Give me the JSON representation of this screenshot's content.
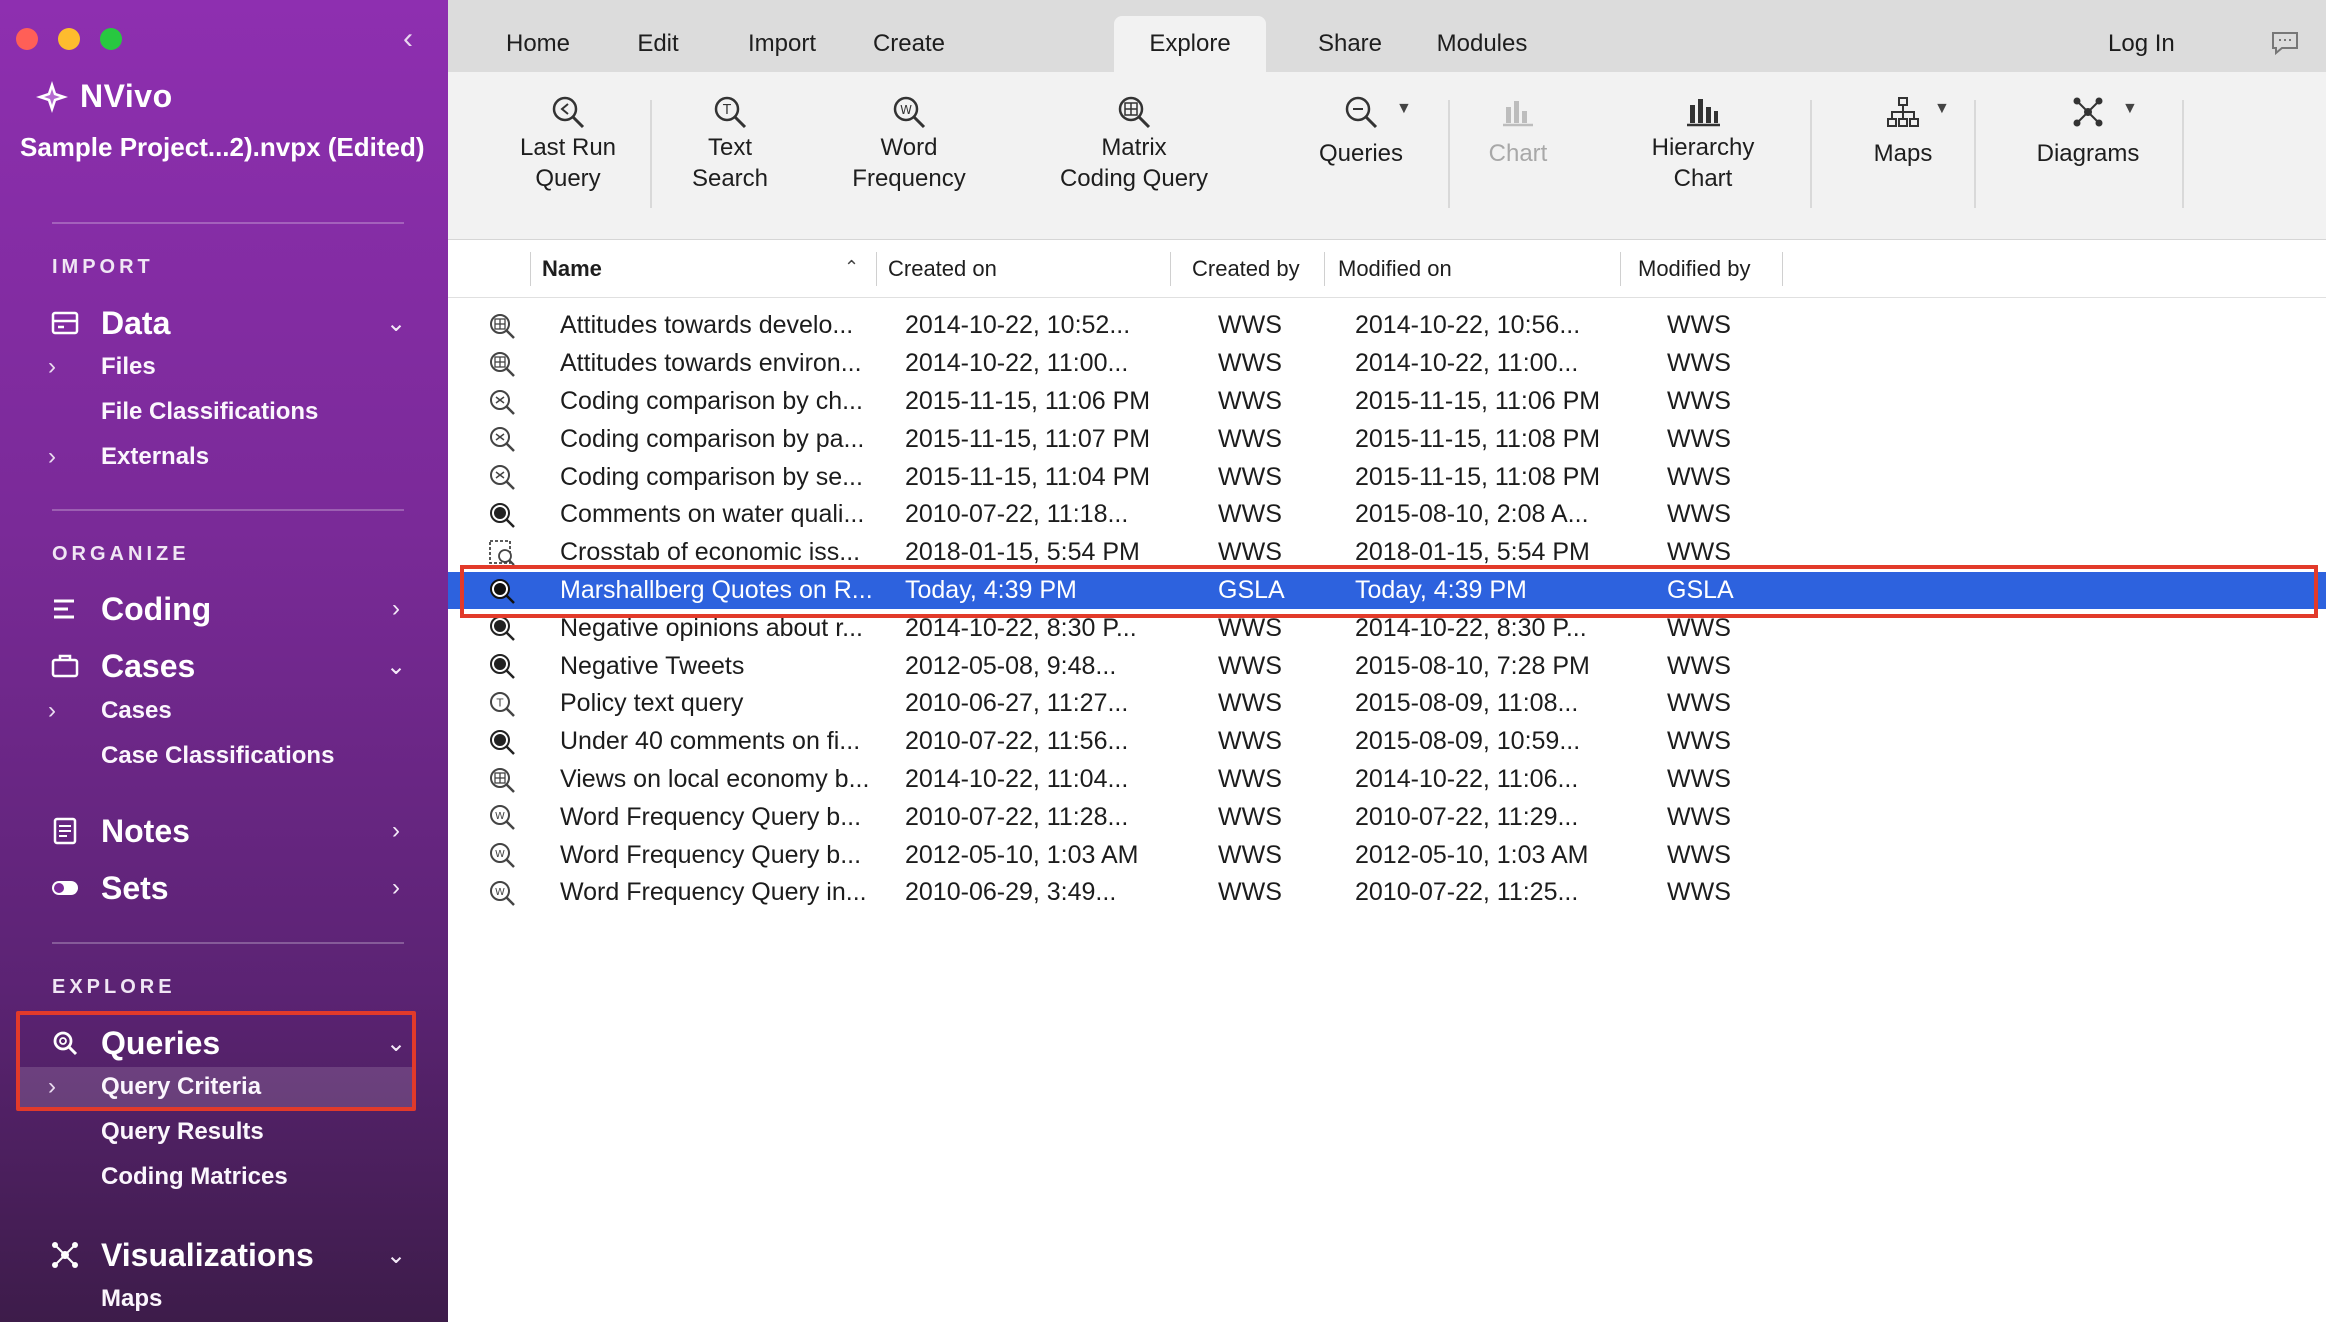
{
  "app": {
    "name": "NVivo",
    "project": "Sample Project...2).nvpx (Edited)"
  },
  "sidebar": {
    "sections": {
      "import": "IMPORT",
      "organize": "ORGANIZE",
      "explore": "EXPLORE"
    },
    "data": {
      "label": "Data",
      "files": "Files",
      "file_classifications": "File Classifications",
      "externals": "Externals"
    },
    "coding": {
      "label": "Coding"
    },
    "cases": {
      "label": "Cases",
      "cases": "Cases",
      "case_classifications": "Case Classifications"
    },
    "notes": {
      "label": "Notes"
    },
    "sets": {
      "label": "Sets"
    },
    "queries": {
      "label": "Queries",
      "query_criteria": "Query Criteria",
      "query_results": "Query Results",
      "coding_matrices": "Coding Matrices"
    },
    "visualizations": {
      "label": "Visualizations",
      "maps": "Maps"
    }
  },
  "tabs": [
    "Home",
    "Edit",
    "Import",
    "Create",
    "Explore",
    "Share",
    "Modules"
  ],
  "active_tab": "Explore",
  "login": "Log In",
  "toolbar": {
    "last_run_query": "Last Run\nQuery",
    "text_search": "Text\nSearch",
    "word_frequency": "Word\nFrequency",
    "matrix_coding_query": "Matrix\nCoding Query",
    "queries": "Queries",
    "chart": "Chart",
    "hierarchy_chart": "Hierarchy\nChart",
    "maps": "Maps",
    "diagrams": "Diagrams"
  },
  "table": {
    "columns": {
      "name": "Name",
      "created_on": "Created on",
      "created_by": "Created by",
      "modified_on": "Modified on",
      "modified_by": "Modified by"
    },
    "rows": [
      {
        "icon": "matrix-query-icon",
        "name": "Attitudes towards develo...",
        "created_on": "2014-10-22, 10:52...",
        "created_by": "WWS",
        "modified_on": "2014-10-22, 10:56...",
        "modified_by": "WWS"
      },
      {
        "icon": "matrix-query-icon",
        "name": "Attitudes towards environ...",
        "created_on": "2014-10-22, 11:00...",
        "created_by": "WWS",
        "modified_on": "2014-10-22, 11:00...",
        "modified_by": "WWS"
      },
      {
        "icon": "comparison-query-icon",
        "name": "Coding comparison by ch...",
        "created_on": "2015-11-15, 11:06 PM",
        "created_by": "WWS",
        "modified_on": "2015-11-15, 11:06 PM",
        "modified_by": "WWS"
      },
      {
        "icon": "comparison-query-icon",
        "name": "Coding comparison by pa...",
        "created_on": "2015-11-15, 11:07 PM",
        "created_by": "WWS",
        "modified_on": "2015-11-15, 11:08 PM",
        "modified_by": "WWS"
      },
      {
        "icon": "comparison-query-icon",
        "name": "Coding comparison by se...",
        "created_on": "2015-11-15, 11:04 PM",
        "created_by": "WWS",
        "modified_on": "2015-11-15, 11:08 PM",
        "modified_by": "WWS"
      },
      {
        "icon": "coding-query-icon",
        "name": "Comments on water quali...",
        "created_on": "2010-07-22, 11:18...",
        "created_by": "WWS",
        "modified_on": "2015-08-10, 2:08 A...",
        "modified_by": "WWS"
      },
      {
        "icon": "crosstab-query-icon",
        "name": "Crosstab of economic iss...",
        "created_on": "2018-01-15, 5:54 PM",
        "created_by": "WWS",
        "modified_on": "2018-01-15, 5:54 PM",
        "modified_by": "WWS"
      },
      {
        "icon": "coding-query-icon",
        "name": "Marshallberg Quotes on R...",
        "created_on": "Today, 4:39 PM",
        "created_by": "GSLA",
        "modified_on": "Today, 4:39 PM",
        "modified_by": "GSLA",
        "selected": true
      },
      {
        "icon": "coding-query-icon",
        "name": "Negative opinions about r...",
        "created_on": "2014-10-22, 8:30 P...",
        "created_by": "WWS",
        "modified_on": "2014-10-22, 8:30 P...",
        "modified_by": "WWS"
      },
      {
        "icon": "coding-query-icon",
        "name": "Negative Tweets",
        "created_on": "2012-05-08, 9:48...",
        "created_by": "WWS",
        "modified_on": "2015-08-10, 7:28 PM",
        "modified_by": "WWS"
      },
      {
        "icon": "text-query-icon",
        "name": "Policy text query",
        "created_on": "2010-06-27, 11:27...",
        "created_by": "WWS",
        "modified_on": "2015-08-09, 11:08...",
        "modified_by": "WWS"
      },
      {
        "icon": "coding-query-icon",
        "name": "Under 40 comments on fi...",
        "created_on": "2010-07-22, 11:56...",
        "created_by": "WWS",
        "modified_on": "2015-08-09, 10:59...",
        "modified_by": "WWS"
      },
      {
        "icon": "matrix-query-icon",
        "name": "Views on local economy b...",
        "created_on": "2014-10-22, 11:04...",
        "created_by": "WWS",
        "modified_on": "2014-10-22, 11:06...",
        "modified_by": "WWS"
      },
      {
        "icon": "word-frequency-icon",
        "name": "Word Frequency Query b...",
        "created_on": "2010-07-22, 11:28...",
        "created_by": "WWS",
        "modified_on": "2010-07-22, 11:29...",
        "modified_by": "WWS"
      },
      {
        "icon": "word-frequency-icon",
        "name": "Word Frequency Query b...",
        "created_on": "2012-05-10, 1:03 AM",
        "created_by": "WWS",
        "modified_on": "2012-05-10, 1:03 AM",
        "modified_by": "WWS"
      },
      {
        "icon": "word-frequency-icon",
        "name": "Word Frequency Query in...",
        "created_on": "2010-06-29, 3:49...",
        "created_by": "WWS",
        "modified_on": "2010-07-22, 11:25...",
        "modified_by": "WWS"
      }
    ]
  },
  "colors": {
    "selection": "#2d62de",
    "highlight_box": "#e23a2a",
    "sidebar_top": "#8e2fb0"
  }
}
